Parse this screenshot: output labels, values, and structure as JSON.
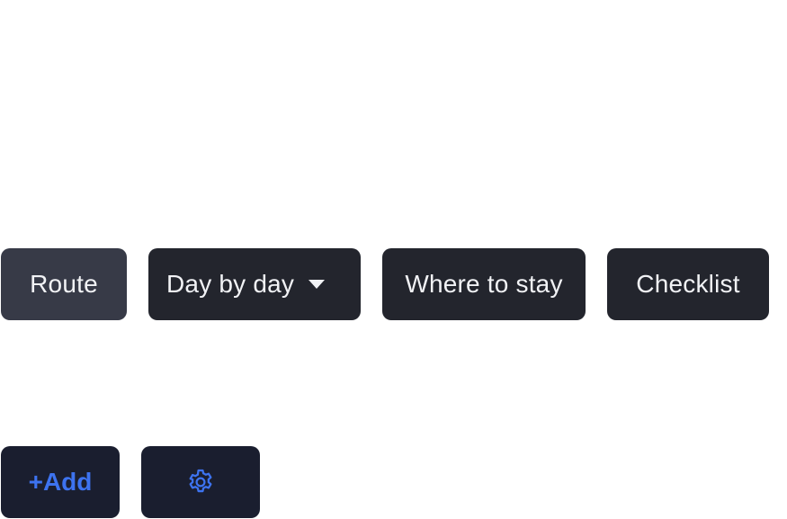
{
  "tabs": [
    {
      "label": "Route",
      "active": true
    },
    {
      "label": "Day by day",
      "has_dropdown": true
    },
    {
      "label": "Where to stay"
    },
    {
      "label": "Checklist"
    }
  ],
  "actions": {
    "add_label": "+Add",
    "settings_icon": "gear-icon"
  },
  "colors": {
    "tab_bg": "#23252d",
    "tab_active_bg": "#373a47",
    "tab_text": "#f1f2f5",
    "action_bg": "#1a1e2f",
    "accent": "#3d73f0"
  }
}
